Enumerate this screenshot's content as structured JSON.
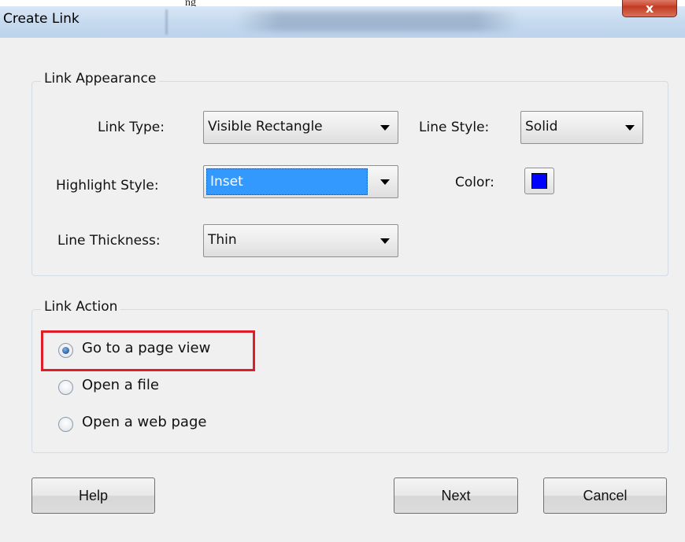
{
  "caption_fragment": "ng",
  "window": {
    "title": "Create Link",
    "close_glyph": "x"
  },
  "appearance": {
    "legend": "Link Appearance",
    "link_type_label": "Link Type:",
    "link_type_value": "Visible Rectangle",
    "line_style_label": "Line Style:",
    "line_style_value": "Solid",
    "highlight_style_label": "Highlight Style:",
    "highlight_style_value": "Inset",
    "color_label": "Color:",
    "color_value": "#0000ff",
    "line_thickness_label": "Line Thickness:",
    "line_thickness_value": "Thin"
  },
  "action": {
    "legend": "Link Action",
    "options": [
      {
        "label": "Go to a page view",
        "checked": true
      },
      {
        "label": "Open a file",
        "checked": false
      },
      {
        "label": "Open a web page",
        "checked": false
      }
    ],
    "highlight_color": "#e01e2a"
  },
  "buttons": {
    "help": "Help",
    "next": "Next",
    "cancel": "Cancel"
  }
}
